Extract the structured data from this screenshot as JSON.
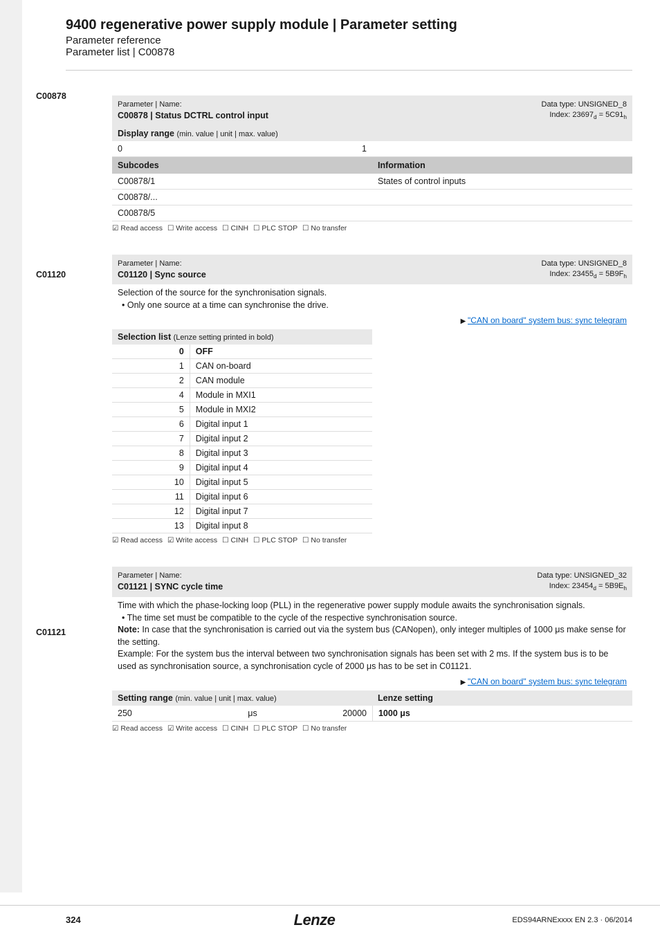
{
  "header": {
    "title": "9400 regenerative power supply module | Parameter setting",
    "sub1": "Parameter reference",
    "sub2": "Parameter list | C00878"
  },
  "footer": {
    "page": "324",
    "logo": "Lenze",
    "doc_id": "EDS94ARNExxxx EN 2.3 · 06/2014"
  },
  "p1": {
    "id": "C00878",
    "name_label": "Parameter | Name:",
    "name": "C00878 | Status DCTRL control input",
    "datatype": "Data type: UNSIGNED_8",
    "index_prefix": "Index: 23697",
    "index_suffix": " = 5C91",
    "display_label": "Display range",
    "display_label_small": "(min. value | unit | max. value)",
    "min": "0",
    "max": "1",
    "sub_hdr1": "Subcodes",
    "sub_hdr2": "Information",
    "r1a": "C00878/1",
    "r1b": "States of control inputs",
    "r2a": "C00878/...",
    "r3a": "C00878/5",
    "access": {
      "read": "☑ Read access",
      "write": "☐ Write access",
      "cinh": "☐ CINH",
      "plc": "☐ PLC STOP",
      "notr": "☐ No transfer"
    }
  },
  "p2": {
    "id": "C01120",
    "name_label": "Parameter | Name:",
    "name": "C01120 | Sync source",
    "datatype": "Data type: UNSIGNED_8",
    "index_prefix": "Index: 23455",
    "index_suffix": " = 5B9F",
    "desc1": "Selection of the source for the synchronisation signals.",
    "desc2": "Only one source at a time can synchronise the drive.",
    "link": "\"CAN on board\" system bus: sync telegram",
    "sel_label": "Selection list",
    "sel_label_small": "(Lenze setting printed in bold)",
    "list": [
      {
        "k": "0",
        "v": "OFF",
        "bold": true
      },
      {
        "k": "1",
        "v": "CAN on-board"
      },
      {
        "k": "2",
        "v": "CAN module"
      },
      {
        "k": "4",
        "v": "Module in MXI1"
      },
      {
        "k": "5",
        "v": "Module in MXI2"
      },
      {
        "k": "6",
        "v": "Digital input 1"
      },
      {
        "k": "7",
        "v": "Digital input 2"
      },
      {
        "k": "8",
        "v": "Digital input 3"
      },
      {
        "k": "9",
        "v": "Digital input 4"
      },
      {
        "k": "10",
        "v": "Digital input 5"
      },
      {
        "k": "11",
        "v": "Digital input 6"
      },
      {
        "k": "12",
        "v": "Digital input 7"
      },
      {
        "k": "13",
        "v": "Digital input 8"
      }
    ],
    "access": {
      "read": "☑ Read access",
      "write": "☑ Write access",
      "cinh": "☐ CINH",
      "plc": "☐ PLC STOP",
      "notr": "☐ No transfer"
    }
  },
  "p3": {
    "id": "C01121",
    "name_label": "Parameter | Name:",
    "name": "C01121 | SYNC cycle time",
    "datatype": "Data type: UNSIGNED_32",
    "index_prefix": "Index: 23454",
    "index_suffix": " = 5B9E",
    "desc1": "Time with which the phase-locking loop (PLL) in the regenerative power supply module awaits the synchronisation signals.",
    "desc2": "The time set must be compatible to the cycle of the respective synchronisation source.",
    "note_label": "Note:",
    "note": " In case that the synchronisation is carried out via the system bus (CANopen), only integer multiples of 1000 μs make sense for the setting.",
    "example": "Example: For the system bus the interval between two synchronisation signals has been set with 2 ms. If the system bus is to be used as synchronisation source, a synchronisation cycle of 2000 μs has to be set in C01121.",
    "link": "\"CAN on board\" system bus: sync telegram",
    "range_label": "Setting range",
    "range_label_small": "(min. value | unit | max. value)",
    "lenze_label": "Lenze setting",
    "min": "250",
    "unit": "μs",
    "max": "20000",
    "default": "1000 μs",
    "access": {
      "read": "☑ Read access",
      "write": "☑ Write access",
      "cinh": "☐ CINH",
      "plc": "☐ PLC STOP",
      "notr": "☐ No transfer"
    }
  }
}
